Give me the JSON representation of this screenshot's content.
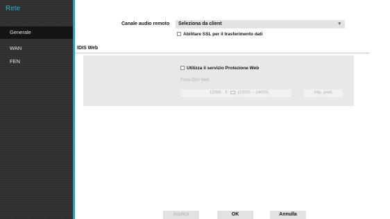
{
  "sidebar": {
    "title": "Rete",
    "items": [
      {
        "label": "Generale",
        "active": true
      },
      {
        "label": "WAN",
        "active": false
      },
      {
        "label": "FEN",
        "active": false
      }
    ]
  },
  "audio": {
    "label": "Canale audio remoto",
    "selected": "Seleziona da client"
  },
  "ssl": {
    "label": "Abilitare SSL per il trasferimento dati",
    "checked": false
  },
  "idis_web": {
    "header": "IDIS Web",
    "use_service_label": "Utilizza il servizio Protezione Web",
    "use_service_checked": false,
    "port_label": "Porta IDIS Web",
    "port_value": "12088",
    "port_range": "(12001 ~ 14000)",
    "default_label": "Imp. pred."
  },
  "footer": {
    "apply": "Applica",
    "ok": "OK",
    "cancel": "Annulla"
  },
  "colors": {
    "accent": "#1fa3bd",
    "sidebar_bg": "#2e2e2e"
  }
}
